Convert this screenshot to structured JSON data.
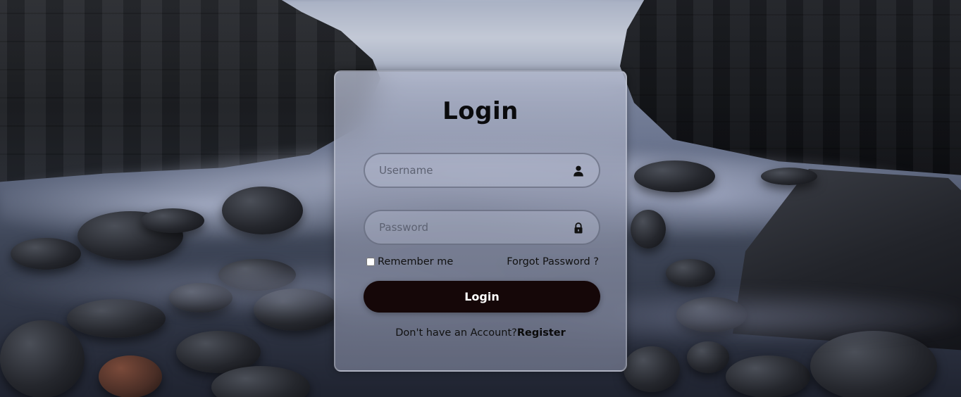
{
  "login": {
    "title": "Login",
    "username": {
      "placeholder": "Username",
      "value": "",
      "icon": "user-icon"
    },
    "password": {
      "placeholder": "Password",
      "value": "",
      "icon": "lock-icon"
    },
    "remember_label": "Remember me",
    "remember_checked": false,
    "forgot_label": "Forgot Password ?",
    "submit_label": "Login",
    "register_prompt": "Don't have an Account?",
    "register_label": "Register"
  },
  "colors": {
    "button_bg": "#150708",
    "button_text": "#ffffff",
    "text": "#111111"
  }
}
